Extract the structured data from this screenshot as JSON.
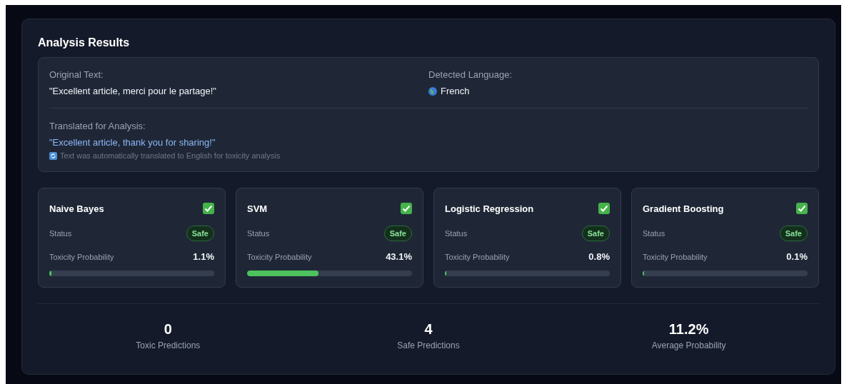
{
  "title": "Analysis Results",
  "original": {
    "label": "Original Text:",
    "text": "\"Excellent article, merci pour le partage!\""
  },
  "language": {
    "label": "Detected Language:",
    "value": "French"
  },
  "translation": {
    "label": "Translated for Analysis:",
    "text": "\"Excellent article, thank you for sharing!\"",
    "note": "Text was automatically translated to English for toxicity analysis"
  },
  "models": [
    {
      "name": "Naive Bayes",
      "toxic": false,
      "status_label": "Status",
      "status": "Safe",
      "prob_label": "Toxicity Probability",
      "prob": "1.1%",
      "level": 0.011
    },
    {
      "name": "SVM",
      "toxic": false,
      "status_label": "Status",
      "status": "Safe",
      "prob_label": "Toxicity Probability",
      "prob": "43.1%",
      "level": 0.431
    },
    {
      "name": "Logistic Regression",
      "toxic": false,
      "status_label": "Status",
      "status": "Safe",
      "prob_label": "Toxicity Probability",
      "prob": "0.8%",
      "level": 0.008
    },
    {
      "name": "Gradient Boosting",
      "toxic": false,
      "status_label": "Status",
      "status": "Safe",
      "prob_label": "Toxicity Probability",
      "prob": "0.1%",
      "level": 0.001
    }
  ],
  "summary": [
    {
      "value": "0",
      "label": "Toxic Predictions"
    },
    {
      "value": "4",
      "label": "Safe Predictions"
    },
    {
      "value": "11.2%",
      "label": "Average Probability"
    }
  ]
}
